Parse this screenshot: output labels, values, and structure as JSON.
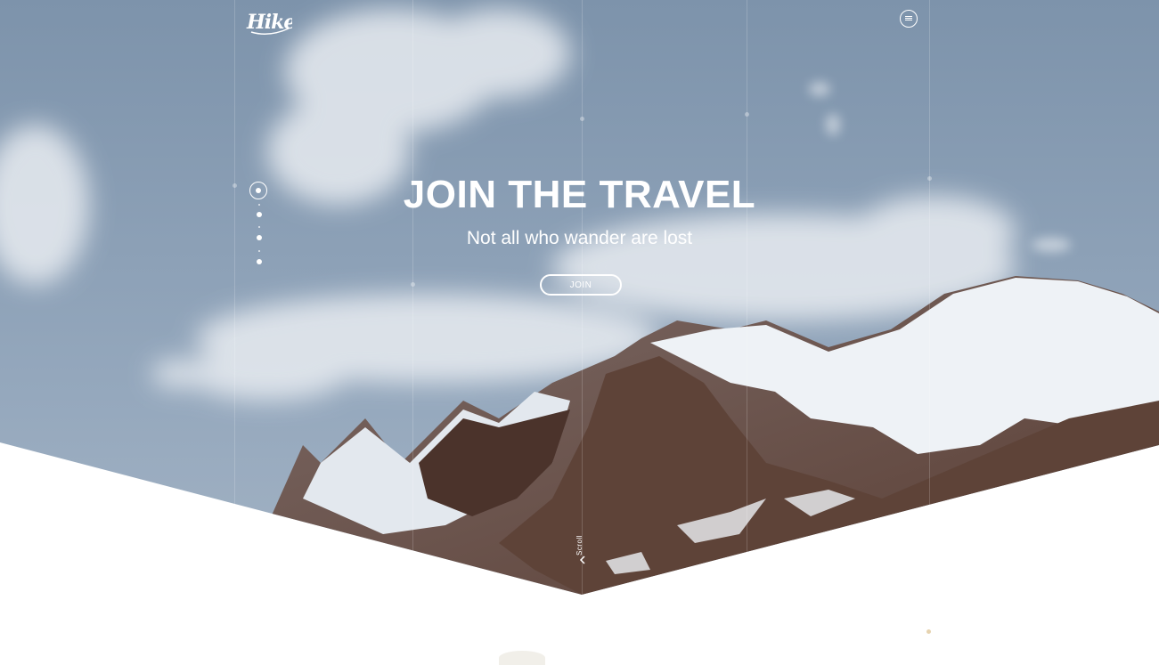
{
  "brand": {
    "logo_text": "Hike",
    "icon": "hike-script-logo"
  },
  "header": {
    "menu_icon": "hamburger-menu-icon"
  },
  "hero": {
    "title": "JOIN THE TRAVEL",
    "subtitle": "Not all who wander are lost",
    "cta_label": "JOIN",
    "slides_total": 4,
    "active_slide": 1
  },
  "scroll": {
    "label": "Scroll",
    "icon": "chevron-down-icon"
  },
  "colors": {
    "sky_top": "#7f95ad",
    "sky_bottom": "#9db0c4",
    "snow": "#eef2f6",
    "rock": "#6b5148",
    "text": "#ffffff",
    "background": "#ffffff"
  }
}
